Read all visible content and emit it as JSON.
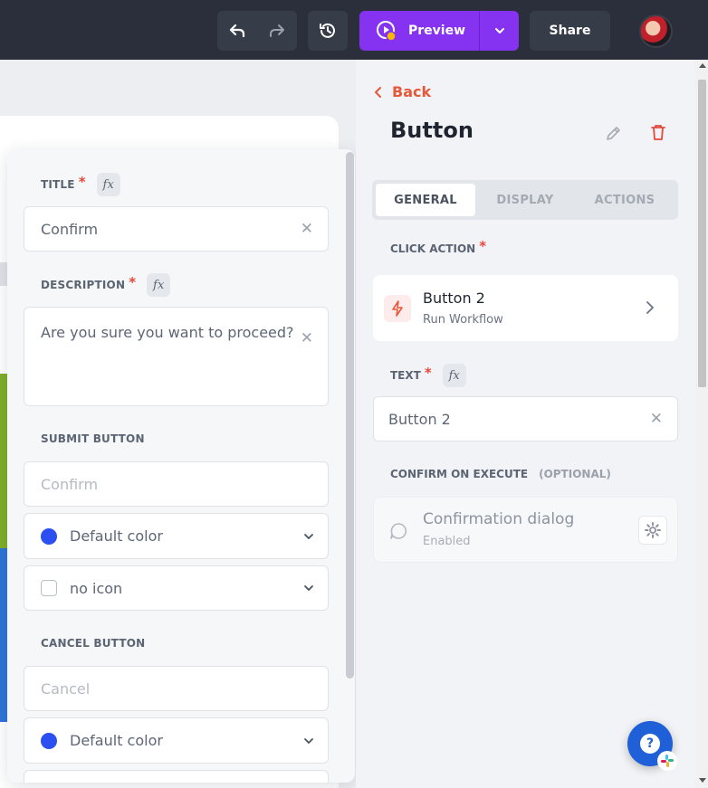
{
  "topbar": {
    "preview_label": "Preview",
    "share_label": "Share",
    "icons": [
      "undo-icon",
      "redo-icon",
      "history-icon",
      "preview-icon",
      "chevron-down-icon"
    ]
  },
  "popover": {
    "title_label": "TITLE",
    "title_value": "Confirm",
    "description_label": "DESCRIPTION",
    "description_value": "Are you sure you want to proceed?",
    "submit_section": "SUBMIT BUTTON",
    "submit_placeholder": "Confirm",
    "submit_color": "Default color",
    "submit_icon": "no icon",
    "cancel_section": "CANCEL BUTTON",
    "cancel_placeholder": "Cancel",
    "cancel_color": "Default color",
    "fx": "fx"
  },
  "panel": {
    "back_label": "Back",
    "title": "Button",
    "tabs": [
      "GENERAL",
      "DISPLAY",
      "ACTIONS"
    ],
    "active_tab": "GENERAL",
    "click_action_label": "CLICK ACTION",
    "action_title": "Button 2",
    "action_subtitle": "Run Workflow",
    "text_label": "TEXT",
    "text_value": "Button 2",
    "confirm_label": "CONFIRM ON EXECUTE",
    "confirm_optional": "(OPTIONAL)",
    "confirm_title": "Confirmation dialog",
    "confirm_subtitle": "Enabled",
    "fx": "fx"
  },
  "help": {
    "label": "?"
  },
  "colors": {
    "accent_purple": "#8533f0",
    "back_orange": "#e5593b",
    "required_red": "#e5483b",
    "color_dot_blue": "#2b4ff0",
    "help_blue": "#1f5fd8"
  }
}
